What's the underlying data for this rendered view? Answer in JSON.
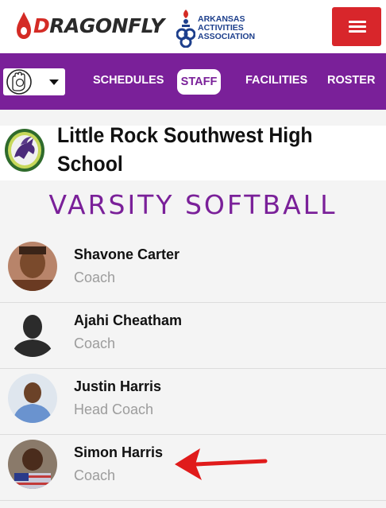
{
  "header": {
    "brand_name": "DRAGONFLY",
    "association_lines": [
      "ARKANSAS",
      "ACTIVITIES",
      "ASSOCIATION"
    ]
  },
  "nav": {
    "sport_icon": "softball-icon",
    "links": [
      "SCHEDULES",
      "STAFF",
      "FACILITIES",
      "ROSTER"
    ],
    "active": "STAFF"
  },
  "school": {
    "name": "Little Rock Southwest High School"
  },
  "team": {
    "title": "VARSITY SOFTBALL"
  },
  "staff": [
    {
      "name": "Shavone Carter",
      "role": "Coach"
    },
    {
      "name": "Ajahi Cheatham",
      "role": "Coach"
    },
    {
      "name": "Justin Harris",
      "role": "Head Coach"
    },
    {
      "name": "Simon Harris",
      "role": "Coach"
    }
  ],
  "colors": {
    "brand_purple": "#7a2099",
    "menu_red": "#d8262b",
    "annotation_arrow": "#e01b1b"
  }
}
